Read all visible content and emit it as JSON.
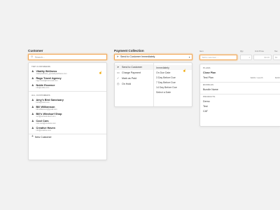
{
  "customer": {
    "label": "Customer",
    "search_placeholder": "Search...",
    "top_heading": "TOP CUSTOMERS",
    "top": [
      {
        "name": "Vitality Wellness",
        "email": "vitalitywellness_@vitalitywellness.com"
      },
      {
        "name": "Rago Travel Agency",
        "email": "rago.travel@hotmmail.com"
      },
      {
        "name": "Noble Essence",
        "email": "info@noble.com"
      }
    ],
    "all_heading": "ALL CUSTOMERS",
    "all": [
      {
        "name": "Amy's Bird Sanctuary",
        "email": "birds@intuit.com"
      },
      {
        "name": "Bill Williamson",
        "email": "bill.williamson@gmail.com"
      },
      {
        "name": "Bill's Windsurf Shop",
        "email": "surf@surfswindsurf.com"
      },
      {
        "name": "Cool Cars",
        "email": "cool.cars@coolcars.com"
      },
      {
        "name": "Creative Haven",
        "email": "info@creative.com"
      }
    ],
    "new_customer": "New Customer"
  },
  "payment": {
    "label": "Payment Collection",
    "selected": "Send to Customer Immediately",
    "options": [
      {
        "icon": "send-icon",
        "glyph": "➤",
        "label": "Send to Customer"
      },
      {
        "icon": "charge-icon",
        "glyph": "▭",
        "label": "Charge Payment"
      },
      {
        "icon": "check-circle-icon",
        "glyph": "✓",
        "label": "Mark as Paid"
      },
      {
        "icon": "clock-icon",
        "glyph": "◷",
        "label": "On Hold"
      }
    ],
    "timing": [
      "Immediately",
      "On Due Date",
      "3 Day Before Due",
      "7 Day Before Due",
      "14 Day Before Due",
      "Select a Date"
    ]
  },
  "items": {
    "columns": {
      "item": "Item",
      "qty": "Qty",
      "unit_price": "Unit Price",
      "tax": "Tax"
    },
    "search_placeholder": "Add a new item ...",
    "qty_value": "1",
    "price_value": "$0.00",
    "tax_value": "$0",
    "plans_heading": "PLANS",
    "plans": [
      {
        "name": "Close Plan",
        "price": ""
      },
      {
        "name": "Test Plan",
        "price": "$100 / month",
        "tax": "$100"
      }
    ],
    "bundles_heading": "BUNDLES",
    "bundles": [
      {
        "name": "Bundle Name"
      }
    ],
    "products_heading": "PRODUCTS",
    "products": [
      {
        "name": "Demo"
      },
      {
        "name": "Test"
      },
      {
        "name": "CAT"
      }
    ]
  }
}
